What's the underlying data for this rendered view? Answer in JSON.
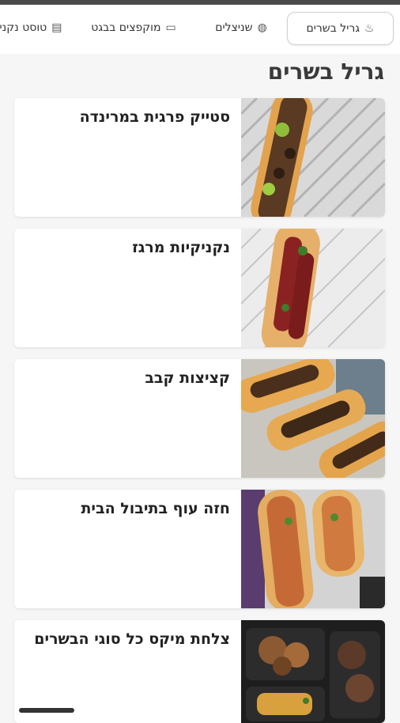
{
  "tabs": [
    {
      "label": "טוסט נקניק",
      "icon": "toast-icon"
    },
    {
      "label": "מוקפצים בבגט",
      "icon": "baguette-icon"
    },
    {
      "label": "שניצלים",
      "icon": "schnitzel-icon"
    },
    {
      "label": "גריל בשרים",
      "icon": "grill-icon",
      "active": true
    }
  ],
  "section": {
    "title": "גריל בשרים"
  },
  "items": [
    {
      "name": "סטייק פרגית במרינדה",
      "image": "chicken-steak-baguette-photo"
    },
    {
      "name": "נקניקיות מרגז",
      "image": "merguez-baguette-photo"
    },
    {
      "name": "קציצות קבב",
      "image": "kebab-baguette-photo"
    },
    {
      "name": "חזה עוף בתיבול הבית",
      "image": "chicken-breast-baguette-photo"
    },
    {
      "name": "צלחת מיקס כל סוגי הבשרים",
      "image": "mixed-meat-plate-photo"
    }
  ],
  "colors": {
    "accent": "#4a4a4a",
    "background": "#f6f6f6",
    "card": "#ffffff"
  }
}
